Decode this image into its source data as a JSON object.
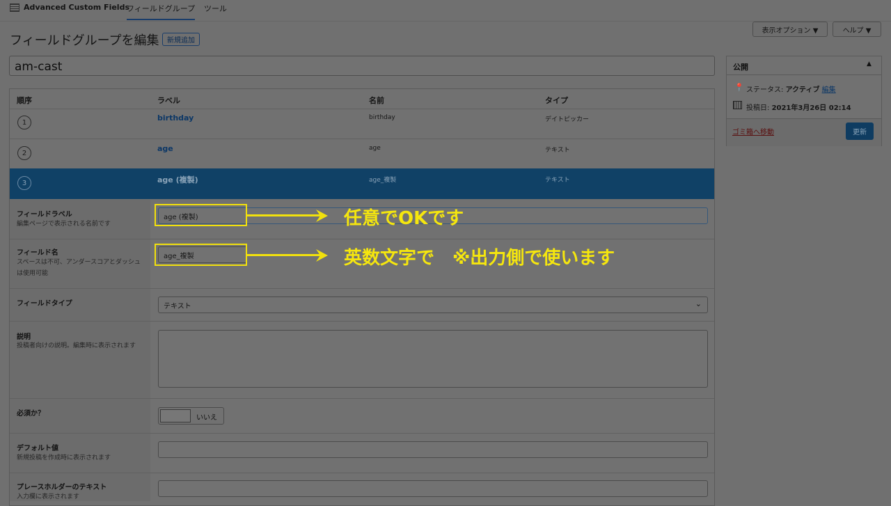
{
  "topbar": {
    "brand": "Advanced Custom Fields",
    "nav": [
      "フィールドグループ",
      "ツール"
    ],
    "screen_options": "表示オプション ▼",
    "help": "ヘルプ ▼"
  },
  "page": {
    "heading": "フィールドグループを編集",
    "add_new": "新規追加",
    "title_value": "am-cast"
  },
  "table": {
    "headers": [
      "順序",
      "ラベル",
      "名前",
      "タイプ"
    ],
    "rows": [
      {
        "order": "1",
        "label": "birthday",
        "name": "birthday",
        "type": "デイトピッカー"
      },
      {
        "order": "2",
        "label": "age",
        "name": "age",
        "type": "テキスト"
      },
      {
        "order": "3",
        "label": "age (複製)",
        "name": "age_複製",
        "type": "テキスト"
      }
    ]
  },
  "settings": {
    "field_label": {
      "title": "フィールドラベル",
      "desc": "編集ページで表示される名前です",
      "value": "age (複製)"
    },
    "field_name": {
      "title": "フィールド名",
      "desc": "スペースは不可、アンダースコアとダッシュは使用可能",
      "value": "age_複製"
    },
    "field_type": {
      "title": "フィールドタイプ",
      "value": "テキスト"
    },
    "instructions": {
      "title": "説明",
      "desc": "投稿者向けの説明。編集時に表示されます"
    },
    "required": {
      "title": "必須か？",
      "toggle_label": "いいえ"
    },
    "default_value": {
      "title": "デフォルト値",
      "desc": "新規投稿を作成時に表示されます"
    },
    "placeholder": {
      "title": "プレースホルダーのテキスト",
      "desc": "入力欄に表示されます"
    }
  },
  "annotations": {
    "label_note": "任意でOKです",
    "name_note": "英数文字で　※出力側で使います",
    "color": "#f2e10c"
  },
  "publish": {
    "title": "公開",
    "status_label": "ステータス:",
    "status_value": "アクティブ",
    "status_edit": "編集",
    "date_label": "投稿日:",
    "date_value": "2021年3月26日 02:14",
    "trash": "ゴミ箱へ移動",
    "update": "更新"
  }
}
